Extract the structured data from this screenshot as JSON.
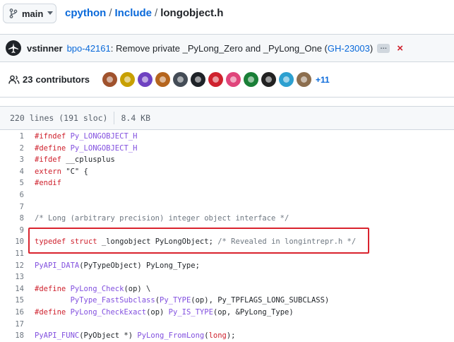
{
  "header": {
    "branch": "main",
    "repo": "cpython",
    "folder": "Include",
    "file": "longobject.h",
    "separator": "/"
  },
  "commit": {
    "author": "vstinner",
    "issue": "bpo-42161",
    "message": ": Remove private _PyLong_Zero and _PyLong_One (",
    "pr": "GH-23003",
    "close_paren": ")",
    "more": "…",
    "close_icon": "×"
  },
  "contributors": {
    "count": "23",
    "label": "contributors",
    "more": "+11",
    "avatar_colors": [
      "#a0522d",
      "#c8a000",
      "#6f42c1",
      "#b5651d",
      "#444c56",
      "#1f2328",
      "#cf222e",
      "#e0457b",
      "#1a7f37",
      "#222222",
      "#2da0d0",
      "#8c6e4e"
    ]
  },
  "file_info": {
    "lines": "220 lines (191 sloc)",
    "size": "8.4 KB"
  },
  "code": [
    {
      "n": "1",
      "parts": [
        [
          "pp",
          "#ifndef"
        ],
        [
          "",
          " "
        ],
        [
          "mac",
          "Py_LONGOBJECT_H"
        ]
      ]
    },
    {
      "n": "2",
      "parts": [
        [
          "pp",
          "#define"
        ],
        [
          "",
          " "
        ],
        [
          "mac",
          "Py_LONGOBJECT_H"
        ]
      ]
    },
    {
      "n": "3",
      "parts": [
        [
          "pp",
          "#ifdef"
        ],
        [
          "",
          " __cplusplus"
        ]
      ]
    },
    {
      "n": "4",
      "parts": [
        [
          "kw",
          "extern"
        ],
        [
          "",
          " \"C\" {"
        ]
      ]
    },
    {
      "n": "5",
      "parts": [
        [
          "pp",
          "#endif"
        ]
      ]
    },
    {
      "n": "6",
      "parts": []
    },
    {
      "n": "7",
      "parts": []
    },
    {
      "n": "8",
      "parts": [
        [
          "cm",
          "/* Long (arbitrary precision) integer object interface */"
        ]
      ]
    },
    {
      "n": "9",
      "parts": []
    },
    {
      "n": "10",
      "parts": [
        [
          "kw",
          "typedef"
        ],
        [
          "",
          " "
        ],
        [
          "kw",
          "struct"
        ],
        [
          "",
          " _longobject PyLongObject; "
        ],
        [
          "cm",
          "/* Revealed in longintrepr.h */"
        ]
      ]
    },
    {
      "n": "11",
      "parts": []
    },
    {
      "n": "12",
      "parts": [
        [
          "fn",
          "PyAPI_DATA"
        ],
        [
          "",
          "(PyTypeObject) PyLong_Type;"
        ]
      ]
    },
    {
      "n": "13",
      "parts": []
    },
    {
      "n": "14",
      "parts": [
        [
          "pp",
          "#define"
        ],
        [
          "",
          " "
        ],
        [
          "fn",
          "PyLong_Check"
        ],
        [
          "",
          "(op) \\"
        ]
      ]
    },
    {
      "n": "15",
      "parts": [
        [
          "",
          "        "
        ],
        [
          "fn",
          "PyType_FastSubclass"
        ],
        [
          "",
          "("
        ],
        [
          "fn",
          "Py_TYPE"
        ],
        [
          "",
          "(op), Py_TPFLAGS_LONG_SUBCLASS)"
        ]
      ]
    },
    {
      "n": "16",
      "parts": [
        [
          "pp",
          "#define"
        ],
        [
          "",
          " "
        ],
        [
          "fn",
          "PyLong_CheckExact"
        ],
        [
          "",
          "(op) "
        ],
        [
          "fn",
          "Py_IS_TYPE"
        ],
        [
          "",
          "(op, &PyLong_Type)"
        ]
      ]
    },
    {
      "n": "17",
      "parts": []
    },
    {
      "n": "18",
      "parts": [
        [
          "fn",
          "PyAPI_FUNC"
        ],
        [
          "",
          "(PyObject *) "
        ],
        [
          "fn",
          "PyLong_FromLong"
        ],
        [
          "",
          "("
        ],
        [
          "kw",
          "long"
        ],
        [
          "",
          ");"
        ]
      ]
    }
  ]
}
